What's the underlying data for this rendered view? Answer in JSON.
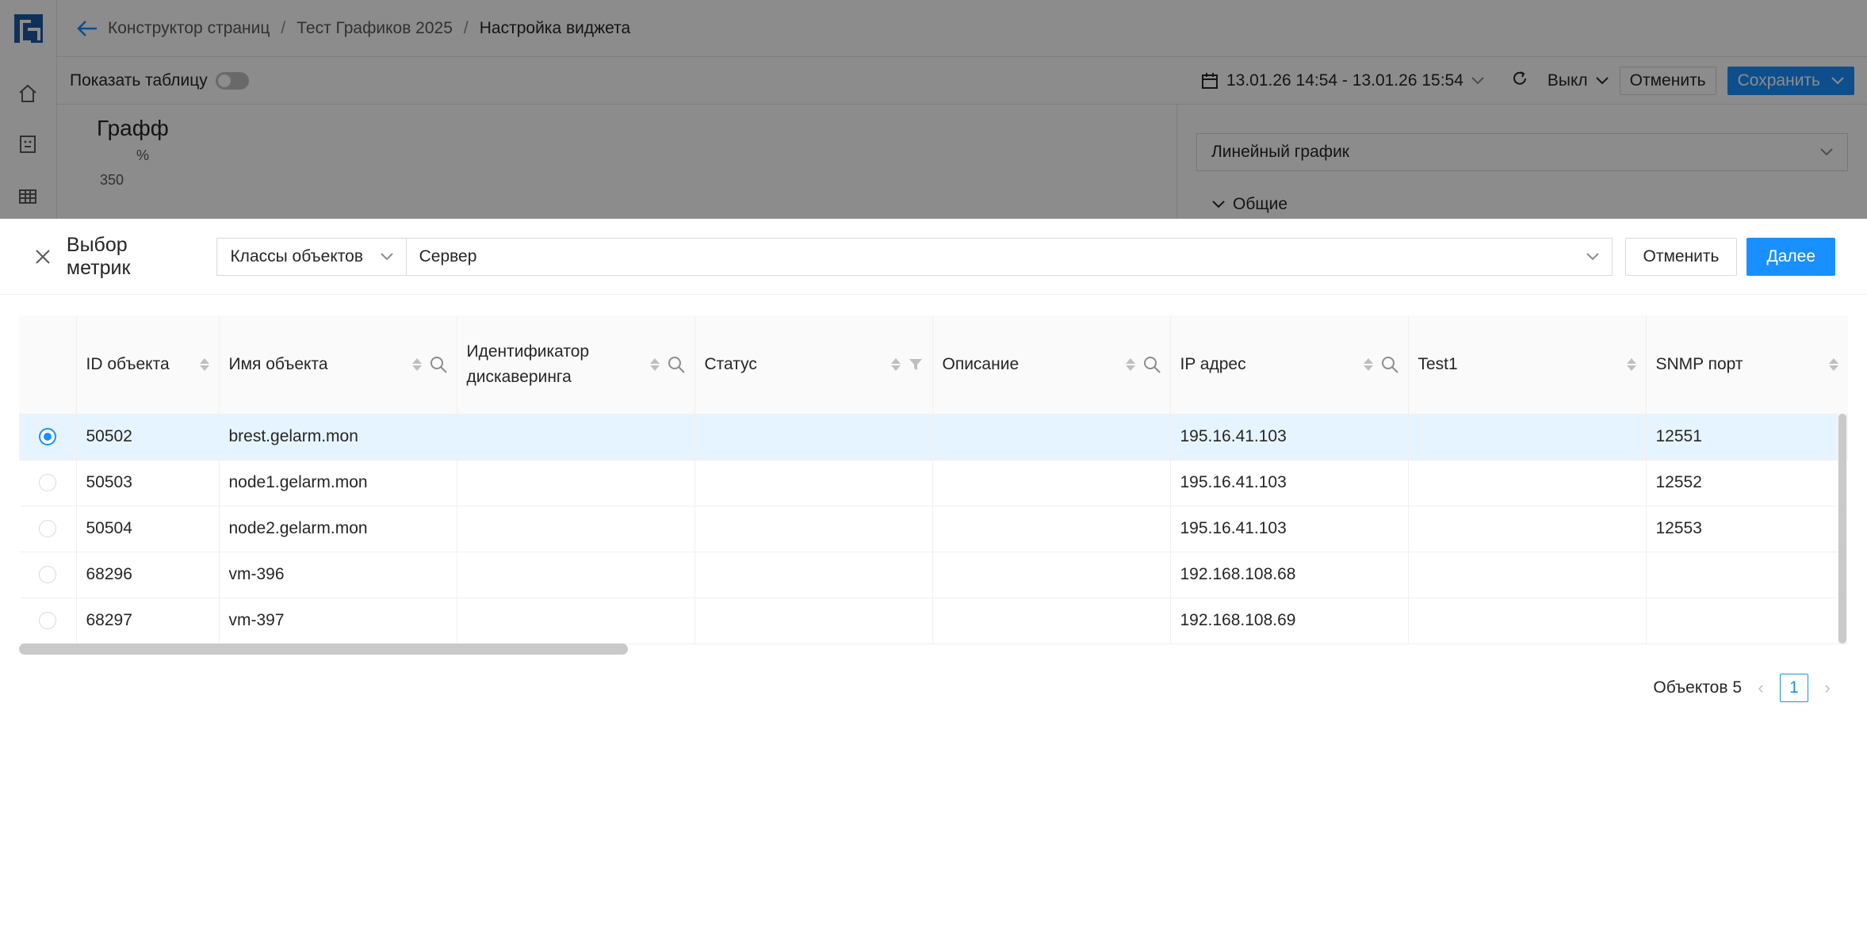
{
  "breadcrumb": {
    "items": [
      "Конструктор страниц",
      "Тест Графиков 2025"
    ],
    "current": "Настройка виджета",
    "separator": "/"
  },
  "toolbar": {
    "show_table_label": "Показать таблицу",
    "date_range": "13.01.26 14:54 - 13.01.26 15:54",
    "refresh_value": "Выкл",
    "cancel_label": "Отменить",
    "save_label": "Сохранить"
  },
  "chart_preview": {
    "title": "Графф",
    "unit": "%",
    "tick": "350"
  },
  "side_panel": {
    "chart_type": "Линейный график",
    "section": "Общие"
  },
  "drawer": {
    "title": "Выбор метрик",
    "class_select": "Классы объектов",
    "value_select": "Сервер",
    "cancel_label": "Отменить",
    "next_label": "Далее"
  },
  "table": {
    "columns": [
      {
        "label": "ID объекта",
        "sort": true,
        "search": false,
        "filter": false
      },
      {
        "label": "Имя объекта",
        "sort": true,
        "search": true,
        "filter": false
      },
      {
        "label": "Идентификатор дискаверинга",
        "sort": true,
        "search": true,
        "filter": false
      },
      {
        "label": "Статус",
        "sort": true,
        "search": false,
        "filter": true
      },
      {
        "label": "Описание",
        "sort": true,
        "search": true,
        "filter": false
      },
      {
        "label": "IP адрес",
        "sort": true,
        "search": true,
        "filter": false
      },
      {
        "label": "Test1",
        "sort": true,
        "search": false,
        "filter": false
      },
      {
        "label": "SNMP порт",
        "sort": true,
        "search": false,
        "filter": false
      }
    ],
    "rows": [
      {
        "selected": true,
        "cells": [
          "50502",
          "brest.gelarm.mon",
          "",
          "",
          "",
          "195.16.41.103",
          "",
          "12551"
        ]
      },
      {
        "selected": false,
        "cells": [
          "50503",
          "node1.gelarm.mon",
          "",
          "",
          "",
          "195.16.41.103",
          "",
          "12552"
        ]
      },
      {
        "selected": false,
        "cells": [
          "50504",
          "node2.gelarm.mon",
          "",
          "",
          "",
          "195.16.41.103",
          "",
          "12553"
        ]
      },
      {
        "selected": false,
        "cells": [
          "68296",
          "vm-396",
          "",
          "",
          "",
          "192.168.108.68",
          "",
          ""
        ]
      },
      {
        "selected": false,
        "cells": [
          "68297",
          "vm-397",
          "",
          "",
          "",
          "192.168.108.69",
          "",
          ""
        ]
      }
    ]
  },
  "pagination": {
    "total_label": "Объектов 5",
    "current_page": "1"
  },
  "colors": {
    "accent": "#1890ff",
    "selected_row": "#e6f4ff",
    "logo": "#1c5a9e"
  }
}
